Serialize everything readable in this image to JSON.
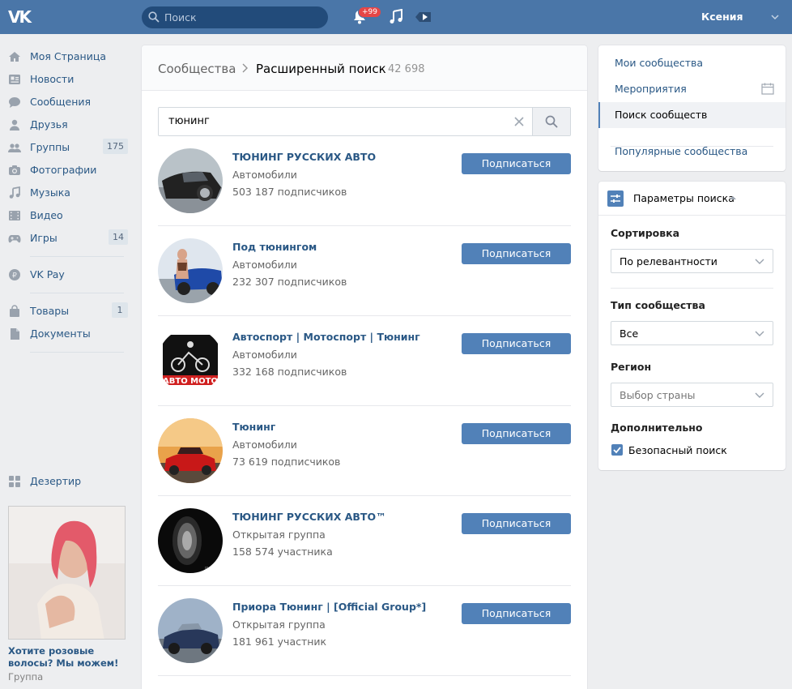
{
  "header": {
    "logo": "VK",
    "search_placeholder": "Поиск",
    "notifications_badge": "+99",
    "user_name": "Ксения"
  },
  "nav": {
    "items": [
      {
        "label": "Моя Страница",
        "icon": "home-icon"
      },
      {
        "label": "Новости",
        "icon": "news-icon"
      },
      {
        "label": "Сообщения",
        "icon": "messages-icon"
      },
      {
        "label": "Друзья",
        "icon": "friends-icon"
      },
      {
        "label": "Группы",
        "icon": "groups-icon",
        "count": "175"
      },
      {
        "label": "Фотографии",
        "icon": "camera-icon"
      },
      {
        "label": "Музыка",
        "icon": "music-icon"
      },
      {
        "label": "Видео",
        "icon": "video-icon"
      },
      {
        "label": "Игры",
        "icon": "gamepad-icon",
        "count": "14"
      }
    ],
    "pay": {
      "label": "VK Pay",
      "icon": "vkpay-icon"
    },
    "items2": [
      {
        "label": "Товары",
        "icon": "bag-icon",
        "count": "1"
      },
      {
        "label": "Документы",
        "icon": "document-icon"
      }
    ],
    "desert": {
      "label": "Дезертир",
      "icon": "apps-icon"
    }
  },
  "ad": {
    "title": "Хотите розовые волосы? Мы можем!",
    "subtitle": "Группа"
  },
  "breadcrumb": {
    "root": "Сообщества",
    "current": "Расширенный поиск",
    "count": "42 698"
  },
  "search": {
    "value": "тюнинг"
  },
  "results": [
    {
      "name": "ТЮНИНГ РУССКИХ АВТО",
      "category": "Автомобили",
      "subs": "503 187 подписчиков",
      "button": "Подписаться"
    },
    {
      "name": "Под тюнингом",
      "category": "Автомобили",
      "subs": "232 307 подписчиков",
      "button": "Подписаться"
    },
    {
      "name": "Автоспорт | Мотоспорт | Тюнинг",
      "category": "Автомобили",
      "subs": "332 168 подписчиков",
      "button": "Подписаться"
    },
    {
      "name": "Тюнинг",
      "category": "Автомобили",
      "subs": "73 619 подписчиков",
      "button": "Подписаться"
    },
    {
      "name": "ТЮНИНГ РУССКИХ АВТО™",
      "category": "Открытая группа",
      "subs": "158 574 участника",
      "button": "Подписаться"
    },
    {
      "name": "Приора Тюнинг | [Official Group*]",
      "category": "Открытая группа",
      "subs": "181 961 участник",
      "button": "Подписаться"
    }
  ],
  "right_menu": {
    "items": [
      "Мои сообщества",
      "Мероприятия",
      "Поиск сообществ",
      "Популярные сообщества"
    ]
  },
  "params": {
    "title": "Параметры поиска",
    "sort_label": "Сортировка",
    "sort_value": "По релевантности",
    "type_label": "Тип сообщества",
    "type_value": "Все",
    "region_label": "Регион",
    "region_value": "Выбор страны",
    "extra_label": "Дополнительно",
    "safe_search": "Безопасный поиск"
  },
  "colors": {
    "header": "#4a76a8",
    "link": "#2a5885",
    "button": "#5181b8"
  }
}
